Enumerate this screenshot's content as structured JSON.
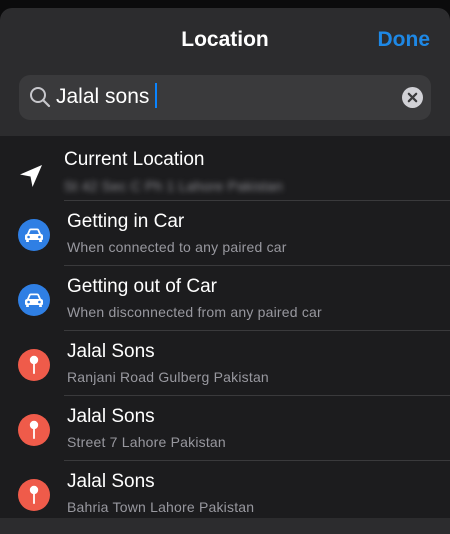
{
  "header": {
    "title": "Location",
    "done_label": "Done"
  },
  "search": {
    "value": "Jalal sons"
  },
  "results": [
    {
      "title": "Current Location",
      "subtitle": "St 42 Sec C Ph 1 Lahore Pakistan",
      "icon": "location-arrow-icon"
    },
    {
      "title": "Getting in Car",
      "subtitle": "When connected to any paired car",
      "icon": "car-icon"
    },
    {
      "title": "Getting out of Car",
      "subtitle": "When disconnected from any paired car",
      "icon": "car-icon"
    },
    {
      "title": "Jalal Sons",
      "subtitle": "Ranjani Road Gulberg Pakistan",
      "icon": "map-pin-icon"
    },
    {
      "title": "Jalal Sons",
      "subtitle": "Street 7 Lahore Pakistan",
      "icon": "map-pin-icon"
    },
    {
      "title": "Jalal Sons",
      "subtitle": "Bahria Town Lahore Pakistan",
      "icon": "map-pin-icon"
    }
  ],
  "colors": {
    "accent": "#1e88e5",
    "car_badge": "#2f7fe4",
    "pin_badge": "#ef5b4a",
    "background": "#1c1c1e"
  }
}
